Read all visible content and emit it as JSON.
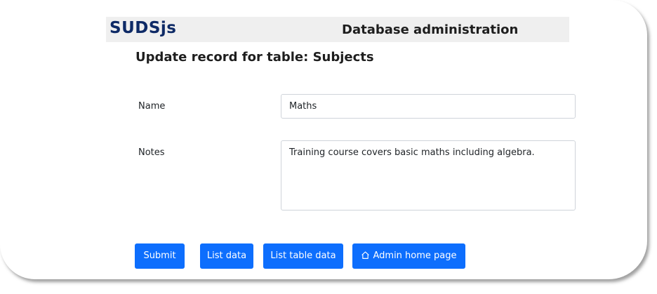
{
  "header": {
    "logo": "SUDSjs",
    "title": "Database administration"
  },
  "page": {
    "title": "Update record for table: Subjects"
  },
  "form": {
    "name_label": "Name",
    "name_value": "Maths",
    "notes_label": "Notes",
    "notes_value": "Training course covers basic maths including algebra."
  },
  "buttons": {
    "submit": "Submit",
    "list_data": "List data",
    "list_table_data": "List table data",
    "admin_home": "Admin home page",
    "admin_home_icon": "house-icon"
  },
  "colors": {
    "accent": "#0d6efd",
    "logo": "#0e2a66",
    "header_bg": "#efefef"
  }
}
